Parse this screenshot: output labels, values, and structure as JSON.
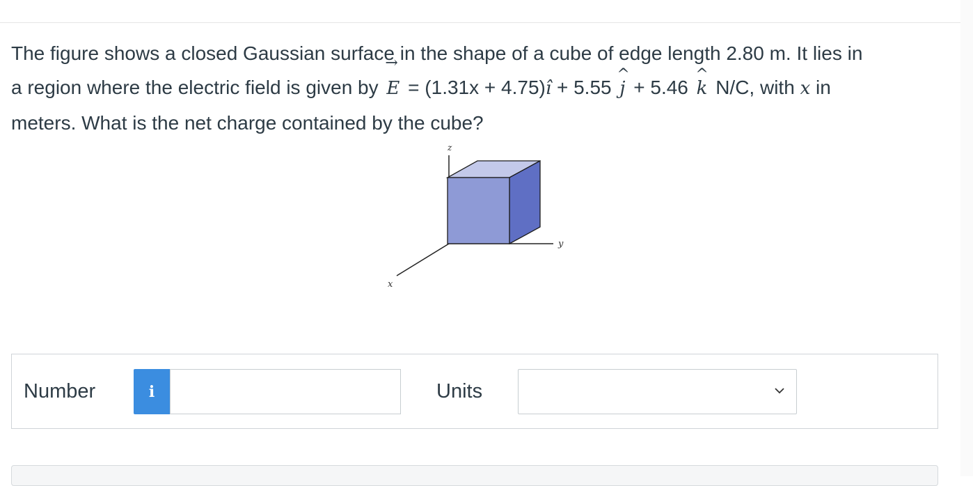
{
  "question": {
    "part1": "The figure shows a closed Gaussian surface in the shape of a cube of edge length 2.80 m. It lies in",
    "part2": "a region where the electric field is given by",
    "vector_symbol": "E",
    "vector_arrow": "→",
    "equation_a": "= (1.31x + 4.75)",
    "unit_i": "î",
    "equation_b": "+ 5.55",
    "unit_j": "j",
    "caret": "^",
    "equation_c": "+ 5.46",
    "unit_k": "k",
    "part3": "N/C, with",
    "x_var": "x",
    "part4": "in",
    "part5": "meters. What is the net charge contained by the cube?"
  },
  "figure": {
    "axis_z": "z",
    "axis_y": "y",
    "axis_x": "x",
    "colors": {
      "front": "#8e9ad6",
      "top": "#c3c9ea",
      "side": "#5f6fc4",
      "edge": "#1c1c1c"
    }
  },
  "answer": {
    "number_label": "Number",
    "info_icon_glyph": "i",
    "number_value": "",
    "units_label": "Units",
    "units_selected": ""
  }
}
